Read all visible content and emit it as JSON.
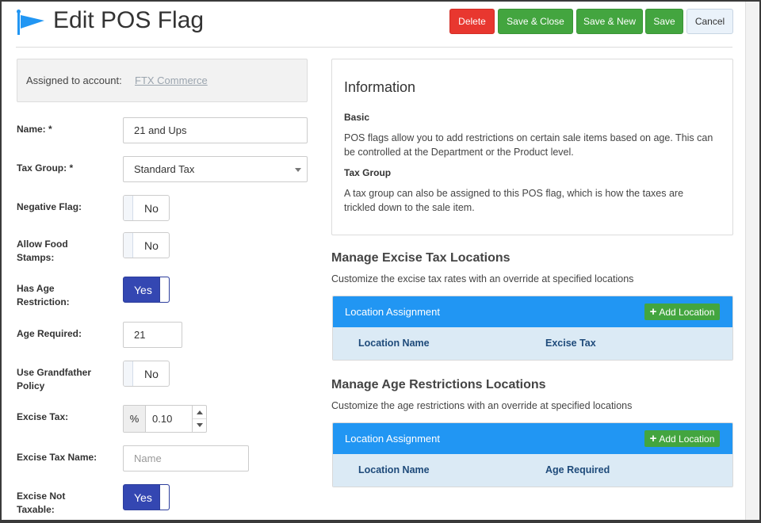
{
  "header": {
    "title": "Edit POS Flag",
    "icon": "flag-icon",
    "buttons": {
      "delete": "Delete",
      "save_close": "Save & Close",
      "save_new": "Save & New",
      "save": "Save",
      "cancel": "Cancel"
    }
  },
  "colors": {
    "danger": "#e8372f",
    "success": "#43a53f",
    "primary": "#2196f3",
    "toggle_on": "#3447b2"
  },
  "form": {
    "assigned_label": "Assigned to account:",
    "assigned_account": "FTX Commerce",
    "name_label": "Name: *",
    "name_value": "21 and Ups",
    "tax_group_label": "Tax Group: *",
    "tax_group_value": "Standard Tax",
    "negative_flag_label": "Negative Flag:",
    "negative_flag_value": "No",
    "food_stamps_label": "Allow Food Stamps:",
    "food_stamps_value": "No",
    "age_restriction_label": "Has Age Restriction:",
    "age_restriction_value": "Yes",
    "age_required_label": "Age Required:",
    "age_required_value": "21",
    "grandfather_label": "Use Grandfather Policy",
    "grandfather_value": "No",
    "excise_tax_label": "Excise Tax:",
    "excise_tax_addon": "%",
    "excise_tax_value": "0.10",
    "excise_tax_name_label": "Excise Tax Name:",
    "excise_tax_name_placeholder": "Name",
    "excise_not_taxable_label": "Excise Not Taxable:",
    "excise_not_taxable_value": "Yes"
  },
  "info": {
    "title": "Information",
    "basic_heading": "Basic",
    "basic_text": "POS flags allow you to add restrictions on certain sale items based on age. This can be controlled at the Department or the Product level.",
    "tax_heading": "Tax Group",
    "tax_text": "A tax group can also be assigned to this POS flag, which is how the taxes are trickled down to the sale item."
  },
  "excise_section": {
    "title": "Manage Excise Tax Locations",
    "subtitle": "Customize the excise tax rates with an override at specified locations",
    "table_title": "Location Assignment",
    "add_label": "Add Location",
    "col1": "Location Name",
    "col2": "Excise Tax"
  },
  "age_section": {
    "title": "Manage Age Restrictions Locations",
    "subtitle": "Customize the age restrictions with an override at specified locations",
    "table_title": "Location Assignment",
    "add_label": "Add Location",
    "col1": "Location Name",
    "col2": "Age Required"
  }
}
